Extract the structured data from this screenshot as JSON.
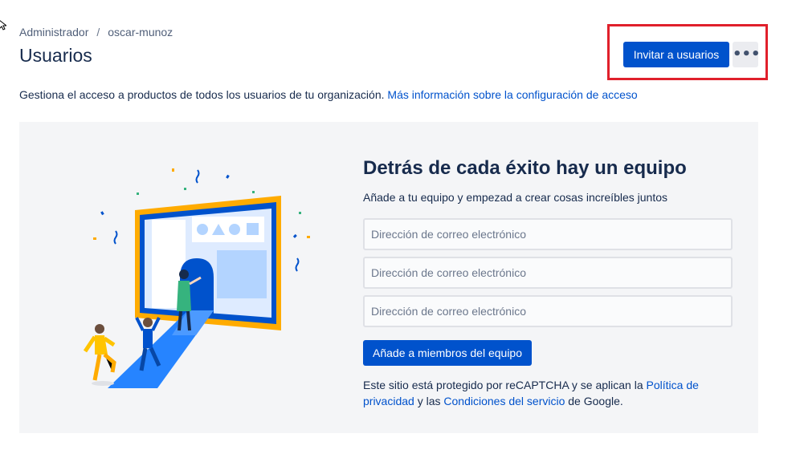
{
  "breadcrumb": {
    "items": [
      "Administrador",
      "oscar-munoz"
    ],
    "separator": "/"
  },
  "page": {
    "title": "Usuarios"
  },
  "header_actions": {
    "invite_label": "Invitar a usuarios",
    "more_icon": "more-horizontal-icon",
    "more_label": "•••"
  },
  "description": {
    "text": "Gestiona el acceso a productos de todos los usuarios de tu organización.",
    "link": "Más información sobre la configuración de acceso"
  },
  "invite_panel": {
    "title": "Detrás de cada éxito hay un equipo",
    "subtitle": "Añade a tu equipo y empezad a crear cosas increíbles juntos",
    "email_placeholders": [
      "Dirección de correo electrónico",
      "Dirección de correo electrónico",
      "Dirección de correo electrónico"
    ],
    "submit_label": "Añade a miembros del equipo",
    "legal": {
      "part1": "Este sitio está protegido por reCAPTCHA y se aplican la",
      "privacy_link": "Política de privacidad",
      "part2": "y las",
      "terms_link": "Condiciones del servicio",
      "part3": "de Google."
    }
  },
  "colors": {
    "primary": "#0052cc",
    "highlight": "#e0202b",
    "panel_bg": "#f4f5f7",
    "text": "#172b4d"
  }
}
